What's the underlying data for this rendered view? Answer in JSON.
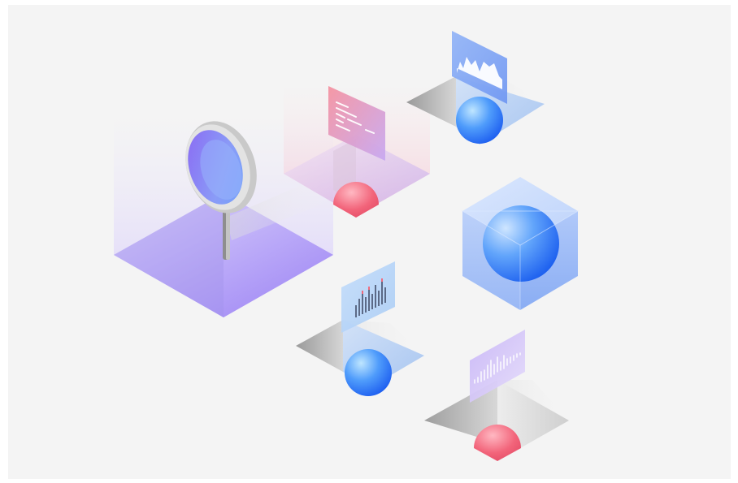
{
  "colors": {
    "background": "#f4f4f4",
    "purple": "#8f7cf7",
    "blue": "#2f7df6",
    "pink": "#f27b8c",
    "light_blue": "#a9c9ff"
  },
  "illustration": {
    "objects": [
      "magnifier-icon",
      "code-card-icon",
      "waveform-card-icon",
      "sphere-in-cube-icon",
      "bar-chart-card-icon",
      "audio-wave-card-icon"
    ]
  }
}
